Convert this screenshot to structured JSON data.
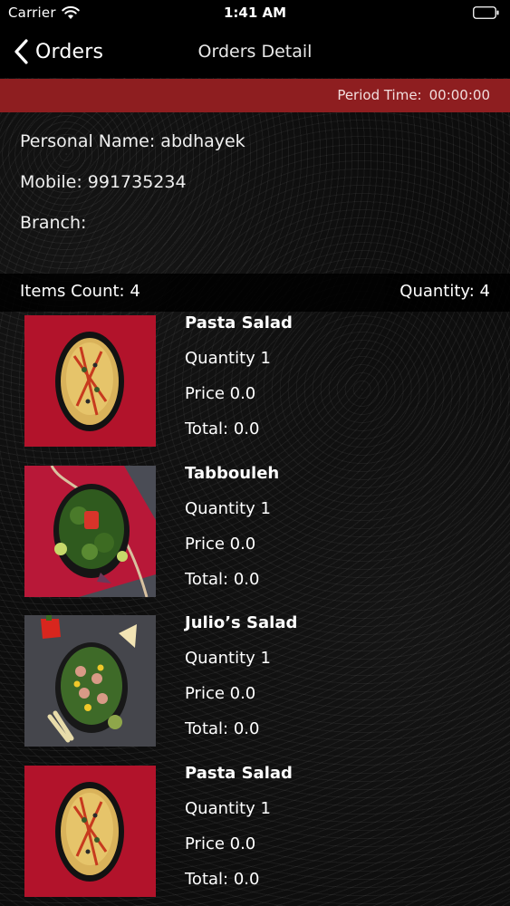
{
  "status_bar": {
    "carrier": "Carrier",
    "time": "1:41 AM"
  },
  "nav": {
    "back_label": "Orders",
    "title": "Orders Detail"
  },
  "period": {
    "label": "Period Time:",
    "value": "00:00:00"
  },
  "customer": {
    "name_line": "Personal Name: abdhayek",
    "mobile_line": "Mobile: 991735234",
    "branch_line": "Branch:"
  },
  "summary": {
    "items_count": "Items Count: 4",
    "quantity": "Quantity: 4"
  },
  "items": [
    {
      "name": "Pasta Salad",
      "quantity": "Quantity 1",
      "price": "Price 0.0",
      "total": "Total: 0.0",
      "image": "pasta-salad-photo"
    },
    {
      "name": "Tabbouleh",
      "quantity": "Quantity 1",
      "price": "Price 0.0",
      "total": "Total: 0.0",
      "image": "tabbouleh-photo"
    },
    {
      "name": "Julio’s Salad",
      "quantity": "Quantity 1",
      "price": "Price 0.0",
      "total": "Total: 0.0",
      "image": "julios-salad-photo"
    },
    {
      "name": "Pasta Salad",
      "quantity": "Quantity 1",
      "price": "Price 0.0",
      "total": "Total: 0.0",
      "image": "pasta-salad-photo"
    }
  ],
  "colors": {
    "accent_red": "#8e1e20",
    "background": "#0d0d0d",
    "bar_black": "#000000"
  }
}
